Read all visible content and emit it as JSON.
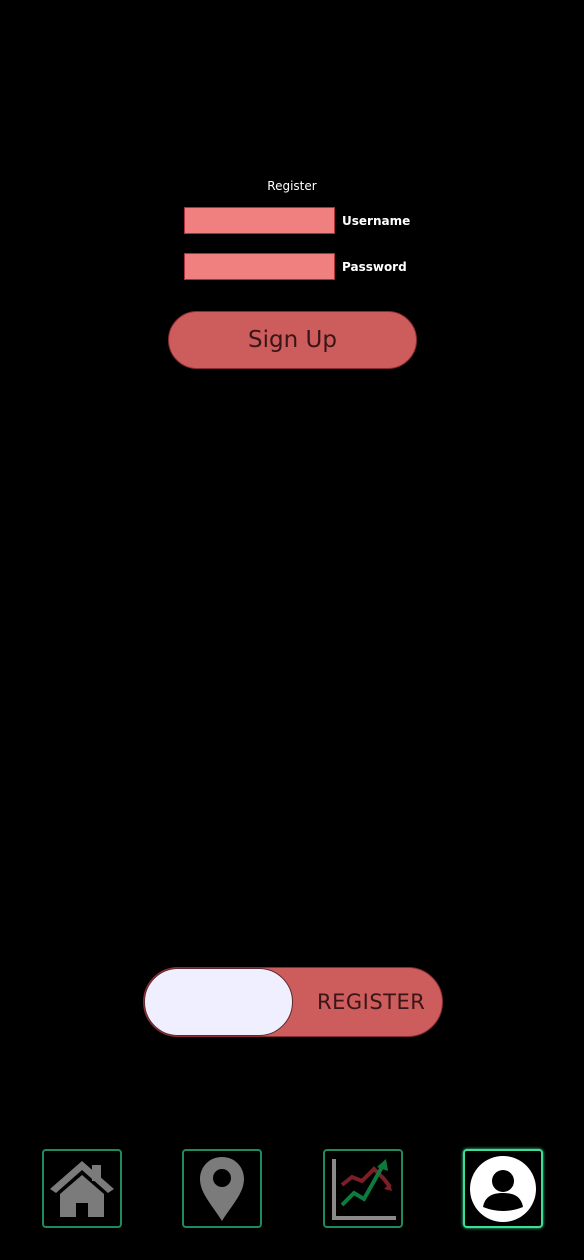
{
  "form": {
    "title": "Register",
    "username_label": "Username",
    "password_label": "Password",
    "username_value": "",
    "password_value": "",
    "submit_label": "Sign Up"
  },
  "mode_toggle": {
    "label": "REGISTER"
  },
  "bottom_nav": {
    "items": [
      {
        "icon": "home-icon",
        "active": false
      },
      {
        "icon": "map-pin-icon",
        "active": false
      },
      {
        "icon": "trend-chart-icon",
        "active": false
      },
      {
        "icon": "user-profile-icon",
        "active": true
      }
    ]
  },
  "colors": {
    "background": "#000000",
    "field_fill": "#f08080",
    "button_fill": "#cd5c5c",
    "toggle_knob": "#efefff",
    "nav_border": "#1f8a5a",
    "nav_active_border": "#3ddc97"
  }
}
